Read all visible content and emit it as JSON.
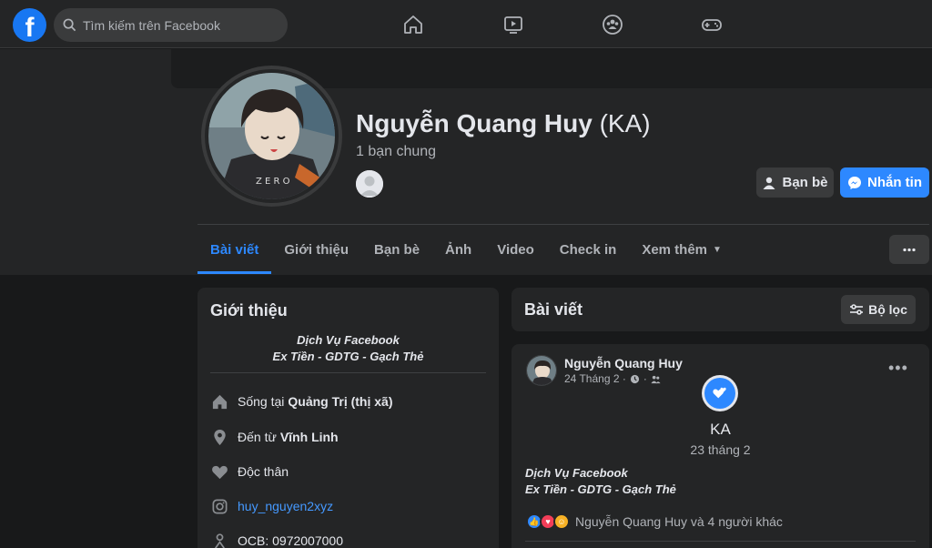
{
  "topbar": {
    "logo_text": "f",
    "search_placeholder": "Tìm kiếm trên Facebook",
    "nav": [
      "home-icon",
      "watch-icon",
      "groups-icon",
      "gaming-icon"
    ]
  },
  "profile": {
    "name": "Nguyễn Quang Huy",
    "alt_name": "(KA)",
    "mutual_friends": "1 bạn chung",
    "btn_friends": "Bạn bè",
    "btn_message": "Nhắn tin"
  },
  "tabs": [
    "Bài viết",
    "Giới thiệu",
    "Bạn bè",
    "Ảnh",
    "Video",
    "Check in",
    "Xem thêm"
  ],
  "intro": {
    "title": "Giới thiệu",
    "bio_line1": "Dịch Vụ Facebook",
    "bio_line2": "Ex Tiền - GDTG - Gạch Thẻ",
    "lives_prefix": "Sống tại",
    "lives_place": "Quảng Trị (thị xã)",
    "from_prefix": "Đến từ",
    "from_place": "Vĩnh Linh",
    "relationship": "Độc thân",
    "instagram": "huy_nguyen2xyz",
    "bank": "OCB: 0972007000"
  },
  "posts": {
    "title": "Bài viết",
    "filter_label": "Bộ lọc",
    "post": {
      "author": "Nguyễn Quang Huy",
      "date": "24 Tháng 2 ·",
      "event_title": "KA",
      "event_date": "23 tháng 2",
      "text_line1": "Dịch Vụ Facebook",
      "text_line2": "Ex Tiền - GDTG - Gạch Thẻ",
      "reactions_text": "Nguyễn Quang Huy và 4 người khác"
    }
  },
  "colors": {
    "accent": "#2d88ff",
    "background": "#18191a",
    "card": "#242526"
  }
}
